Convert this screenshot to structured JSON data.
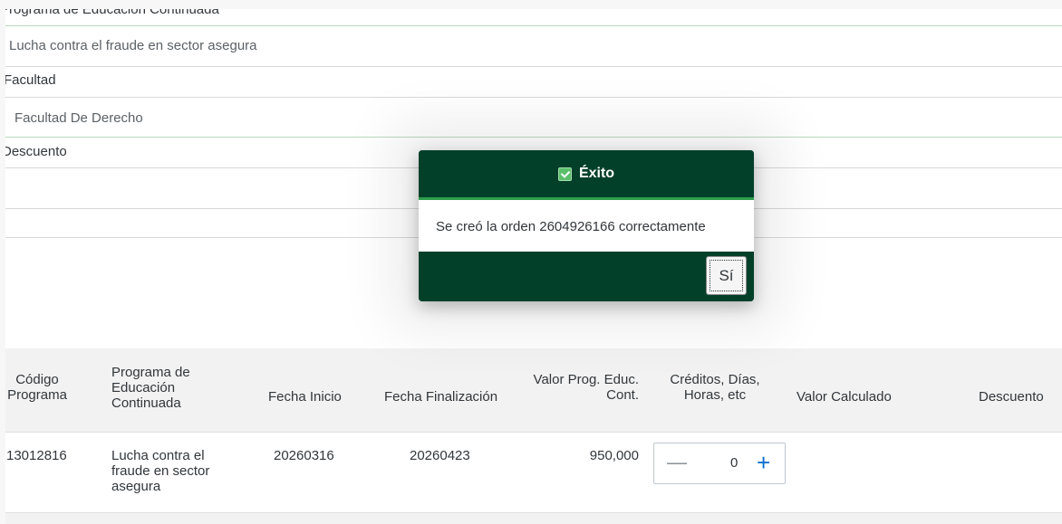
{
  "form": {
    "program_label": "Programa de Educación Continuada",
    "program_value": "Lucha contra el fraude en sector asegura",
    "faculty_label": "Facultad",
    "faculty_value": "Facultad De Derecho",
    "discount_label": "Descuento"
  },
  "table": {
    "headers": {
      "codigo": "Código Programa",
      "programa": "Programa de Educación Continuada",
      "fecha_inicio": "Fecha Inicio",
      "fecha_fin": "Fecha Finalización",
      "valor_prog": "Valor Prog. Educ. Cont.",
      "creditos": "Créditos, Días, Horas, etc",
      "valor_calc": "Valor Calculado",
      "descuento": "Descuento"
    },
    "rows": [
      {
        "codigo": "13012816",
        "programa": "Lucha contra el fraude en sector asegura",
        "fecha_inicio": "20260316",
        "fecha_fin": "20260423",
        "valor_prog": "950,000",
        "creditos": "0",
        "valor_calc": "",
        "descuento": ""
      }
    ]
  },
  "dialog": {
    "title": "Éxito",
    "message": "Se creó la orden 2604926166 correctamente",
    "ok_label": "Sí",
    "icon": "checkbox-success-icon"
  },
  "stepper": {
    "decrement_symbol": "—",
    "increment_symbol": "+"
  },
  "colors": {
    "dialog_bg": "#03402a",
    "dialog_accent": "#2e9e4a",
    "stepper_accent": "#0a6ed1"
  }
}
